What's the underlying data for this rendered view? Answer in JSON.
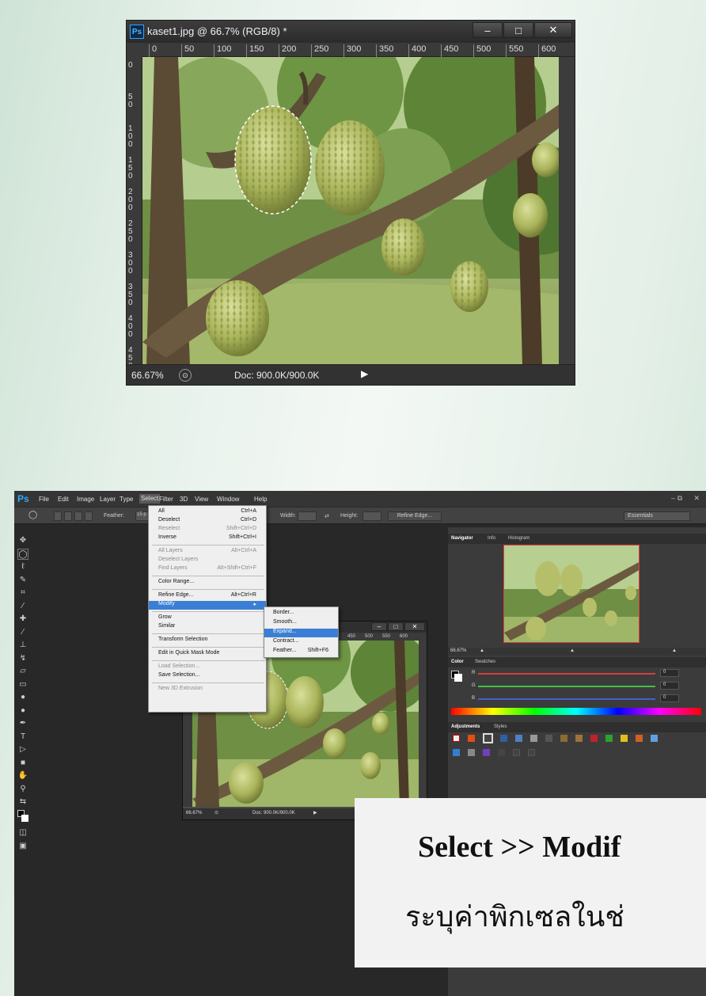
{
  "top_window": {
    "title": "kaset1.jpg @ 66.7% (RGB/8) *",
    "ps_badge": "Ps",
    "minimize_glyph": "‒",
    "maximize_glyph": "□",
    "close_glyph": "✕",
    "ruler_h": [
      "0",
      "50",
      "100",
      "150",
      "200",
      "250",
      "300",
      "350",
      "400",
      "450",
      "500",
      "550",
      "600"
    ],
    "ruler_v": [
      "0",
      "50",
      "100",
      "150",
      "200",
      "250",
      "300",
      "350",
      "400",
      "450"
    ],
    "zoom": "66.67%",
    "doc_size": "Doc: 900.0K/900.0K"
  },
  "ps_app": {
    "logo": "Ps",
    "menus": [
      "File",
      "Edit",
      "Image",
      "Layer",
      "Type",
      "Select",
      "Filter",
      "3D",
      "View",
      "Window",
      "Help"
    ],
    "options": {
      "feather_label": "Feather:",
      "feather_value": "15 p",
      "width_label": "Width:",
      "height_label": "Height:",
      "refine_edge": "Refine Edge...",
      "workspace": "Essentials"
    },
    "select_menu": [
      {
        "label": "All",
        "shortcut": "Ctrl+A",
        "state": "normal"
      },
      {
        "label": "Deselect",
        "shortcut": "Ctrl+D",
        "state": "normal"
      },
      {
        "label": "Reselect",
        "shortcut": "Shift+Ctrl+D",
        "state": "disabled"
      },
      {
        "label": "Inverse",
        "shortcut": "Shift+Ctrl+I",
        "state": "normal"
      },
      {
        "label": "All Layers",
        "shortcut": "Alt+Ctrl+A",
        "state": "disabled"
      },
      {
        "label": "Deselect Layers",
        "shortcut": "",
        "state": "disabled"
      },
      {
        "label": "Find Layers",
        "shortcut": "Alt+Shift+Ctrl+F",
        "state": "disabled"
      },
      {
        "label": "Color Range...",
        "shortcut": "",
        "state": "normal"
      },
      {
        "label": "Refine Edge...",
        "shortcut": "Alt+Ctrl+R",
        "state": "normal"
      },
      {
        "label": "Modify",
        "shortcut": "▸",
        "state": "highlighted"
      },
      {
        "label": "Grow",
        "shortcut": "",
        "state": "normal"
      },
      {
        "label": "Similar",
        "shortcut": "",
        "state": "normal"
      },
      {
        "label": "Transform Selection",
        "shortcut": "",
        "state": "normal"
      },
      {
        "label": "Edit in Quick Mask Mode",
        "shortcut": "",
        "state": "normal"
      },
      {
        "label": "Load Selection...",
        "shortcut": "",
        "state": "disabled"
      },
      {
        "label": "Save Selection...",
        "shortcut": "",
        "state": "normal"
      },
      {
        "label": "New 3D Extrusion",
        "shortcut": "",
        "state": "disabled"
      }
    ],
    "modify_menu": [
      {
        "label": "Border...",
        "shortcut": "",
        "state": "normal"
      },
      {
        "label": "Smooth...",
        "shortcut": "",
        "state": "normal"
      },
      {
        "label": "Expand...",
        "shortcut": "",
        "state": "highlighted"
      },
      {
        "label": "Contract...",
        "shortcut": "",
        "state": "normal"
      },
      {
        "label": "Feather...",
        "shortcut": "Shift+F6",
        "state": "normal"
      }
    ],
    "mini_doc": {
      "ruler": [
        "450",
        "500",
        "550",
        "600"
      ],
      "zoom": "66.67%",
      "doc_size": "Doc: 900.0K/900.0K"
    },
    "panels": {
      "nav_tabs": [
        "Navigator",
        "Info",
        "Histogram"
      ],
      "zoom": "66.67%",
      "color_tabs": [
        "Color",
        "Swatches"
      ],
      "rgb_labels": [
        "R",
        "G",
        "B"
      ],
      "rgb_values": [
        "0",
        "0",
        "0"
      ],
      "style_tabs": [
        "Adjustments",
        "Styles"
      ]
    }
  },
  "caption": {
    "line1": "Select >> Modif",
    "line2": "ระบุค่าพิกเซลในช่"
  },
  "colors": {
    "ps_blue": "#31a8ff",
    "menu_highlight": "#3a7fd5",
    "caption_bg": "#f2f2f2"
  }
}
